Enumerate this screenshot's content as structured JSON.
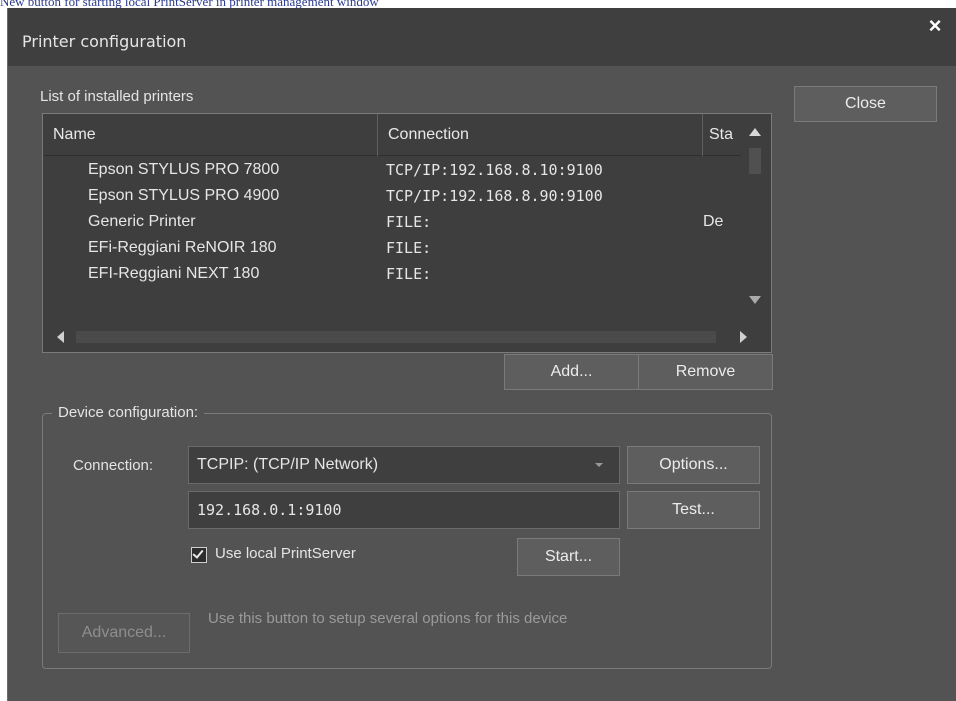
{
  "caption": "New button for starting local PrintServer in printer management window",
  "window": {
    "title": "Printer configuration",
    "close_glyph": "×"
  },
  "close_button_label": "Close",
  "printers_section_label": "List of installed printers",
  "printers_table": {
    "columns": [
      "Name",
      "Connection",
      "Sta"
    ],
    "rows": [
      {
        "name": "Epson STYLUS PRO 7800",
        "connection": "TCP/IP:192.168.8.10:9100",
        "status": ""
      },
      {
        "name": "Epson STYLUS PRO 4900",
        "connection": "TCP/IP:192.168.8.90:9100",
        "status": ""
      },
      {
        "name": "Generic Printer",
        "connection": "FILE:",
        "status": "De"
      },
      {
        "name": "EFi-Reggiani ReNOIR 180",
        "connection": "FILE:",
        "status": ""
      },
      {
        "name": "EFI-Reggiani NEXT 180",
        "connection": "FILE:",
        "status": ""
      }
    ]
  },
  "add_label": "Add...",
  "remove_label": "Remove",
  "device_config": {
    "legend": "Device configuration:",
    "connection_label": "Connection:",
    "connection_value": "TCPIP: (TCP/IP Network)",
    "options_label": "Options...",
    "address_value": "192.168.0.1:9100",
    "test_label": "Test...",
    "use_local_label": "Use local PrintServer",
    "use_local_checked": true,
    "start_label": "Start...",
    "advanced_label": "Advanced...",
    "advanced_hint": "Use this button to setup several options for this device"
  },
  "icons": {
    "close": "close-icon",
    "scroll_up": "arrow-up-icon",
    "scroll_down": "arrow-down-icon",
    "scroll_left": "arrow-left-icon",
    "scroll_right": "arrow-right-icon",
    "dropdown": "chevron-down-icon",
    "checkbox": "checkmark-icon"
  },
  "colors": {
    "dialog_bg": "#535353",
    "titlebar_bg": "#3f3f3f",
    "list_bg": "#3e3e3e",
    "border": "#7a7a7a",
    "text": "#e6e6e6",
    "disabled_text": "#9a9a9a",
    "window_edge": "#2a7bd0"
  }
}
